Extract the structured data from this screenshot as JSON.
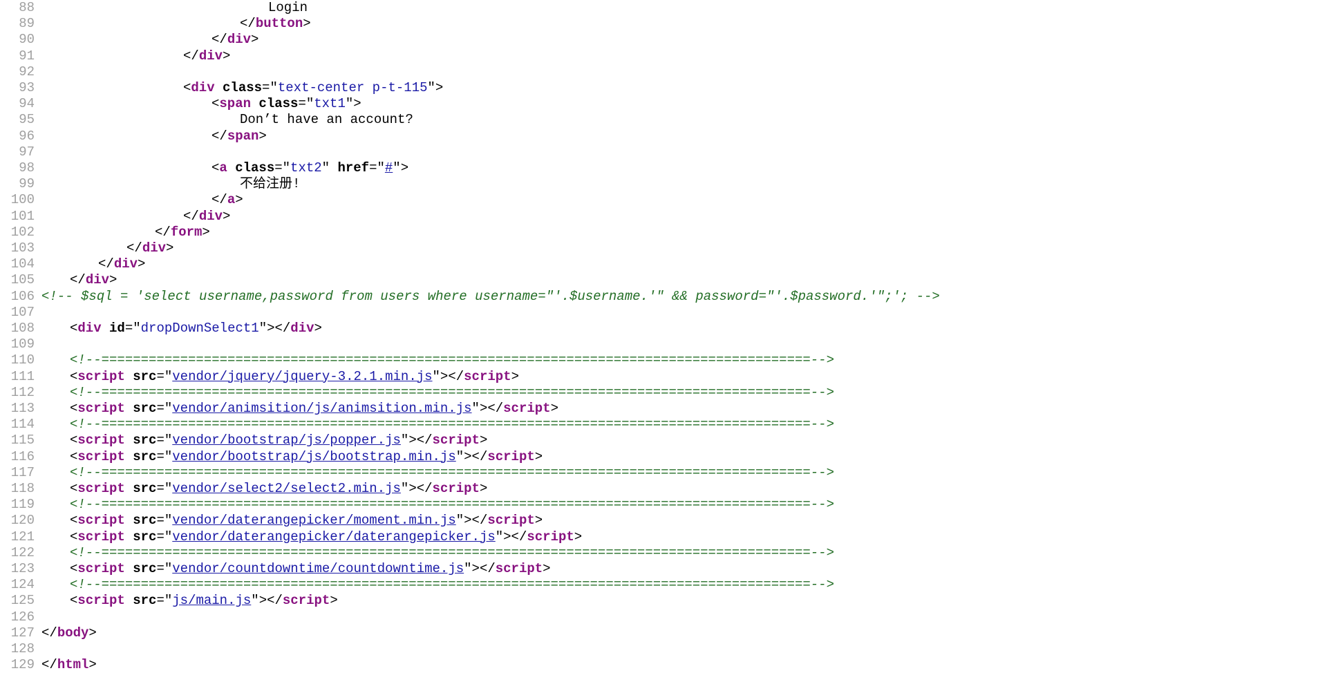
{
  "source_view": {
    "lines": [
      {
        "n": "88",
        "indent": 32,
        "parts": [
          {
            "k": "txt",
            "t": "Login"
          }
        ]
      },
      {
        "n": "89",
        "indent": 28,
        "parts": [
          {
            "k": "punct",
            "t": "</"
          },
          {
            "k": "tag",
            "t": "button"
          },
          {
            "k": "punct",
            "t": ">"
          }
        ]
      },
      {
        "n": "90",
        "indent": 24,
        "parts": [
          {
            "k": "punct",
            "t": "</"
          },
          {
            "k": "tag",
            "t": "div"
          },
          {
            "k": "punct",
            "t": ">"
          }
        ]
      },
      {
        "n": "91",
        "indent": 20,
        "parts": [
          {
            "k": "punct",
            "t": "</"
          },
          {
            "k": "tag",
            "t": "div"
          },
          {
            "k": "punct",
            "t": ">"
          }
        ]
      },
      {
        "n": "92",
        "indent": 0,
        "parts": []
      },
      {
        "n": "93",
        "indent": 20,
        "parts": [
          {
            "k": "punct",
            "t": "<"
          },
          {
            "k": "tag",
            "t": "div"
          },
          {
            "k": "txt",
            "t": " "
          },
          {
            "k": "attr",
            "t": "class"
          },
          {
            "k": "punct",
            "t": "=\""
          },
          {
            "k": "val",
            "t": "text-center p-t-115"
          },
          {
            "k": "punct",
            "t": "\">"
          }
        ]
      },
      {
        "n": "94",
        "indent": 24,
        "parts": [
          {
            "k": "punct",
            "t": "<"
          },
          {
            "k": "tag",
            "t": "span"
          },
          {
            "k": "txt",
            "t": " "
          },
          {
            "k": "attr",
            "t": "class"
          },
          {
            "k": "punct",
            "t": "=\""
          },
          {
            "k": "val",
            "t": "txt1"
          },
          {
            "k": "punct",
            "t": "\">"
          }
        ]
      },
      {
        "n": "95",
        "indent": 28,
        "parts": [
          {
            "k": "txt",
            "t": "Don’t have an account?"
          }
        ]
      },
      {
        "n": "96",
        "indent": 24,
        "parts": [
          {
            "k": "punct",
            "t": "</"
          },
          {
            "k": "tag",
            "t": "span"
          },
          {
            "k": "punct",
            "t": ">"
          }
        ]
      },
      {
        "n": "97",
        "indent": 0,
        "parts": []
      },
      {
        "n": "98",
        "indent": 24,
        "parts": [
          {
            "k": "punct",
            "t": "<"
          },
          {
            "k": "tag",
            "t": "a"
          },
          {
            "k": "txt",
            "t": " "
          },
          {
            "k": "attr",
            "t": "class"
          },
          {
            "k": "punct",
            "t": "=\""
          },
          {
            "k": "val",
            "t": "txt2"
          },
          {
            "k": "punct",
            "t": "\" "
          },
          {
            "k": "attr",
            "t": "href"
          },
          {
            "k": "punct",
            "t": "=\""
          },
          {
            "k": "lnk",
            "t": "#"
          },
          {
            "k": "punct",
            "t": "\">"
          }
        ]
      },
      {
        "n": "99",
        "indent": 28,
        "parts": [
          {
            "k": "txt",
            "t": "不给注册!"
          }
        ]
      },
      {
        "n": "100",
        "indent": 24,
        "parts": [
          {
            "k": "punct",
            "t": "</"
          },
          {
            "k": "tag",
            "t": "a"
          },
          {
            "k": "punct",
            "t": ">"
          }
        ]
      },
      {
        "n": "101",
        "indent": 20,
        "parts": [
          {
            "k": "punct",
            "t": "</"
          },
          {
            "k": "tag",
            "t": "div"
          },
          {
            "k": "punct",
            "t": ">"
          }
        ]
      },
      {
        "n": "102",
        "indent": 16,
        "parts": [
          {
            "k": "punct",
            "t": "</"
          },
          {
            "k": "tag",
            "t": "form"
          },
          {
            "k": "punct",
            "t": ">"
          }
        ]
      },
      {
        "n": "103",
        "indent": 12,
        "parts": [
          {
            "k": "punct",
            "t": "</"
          },
          {
            "k": "tag",
            "t": "div"
          },
          {
            "k": "punct",
            "t": ">"
          }
        ]
      },
      {
        "n": "104",
        "indent": 8,
        "parts": [
          {
            "k": "punct",
            "t": "</"
          },
          {
            "k": "tag",
            "t": "div"
          },
          {
            "k": "punct",
            "t": ">"
          }
        ]
      },
      {
        "n": "105",
        "indent": 4,
        "parts": [
          {
            "k": "punct",
            "t": "</"
          },
          {
            "k": "tag",
            "t": "div"
          },
          {
            "k": "punct",
            "t": ">"
          }
        ]
      },
      {
        "n": "106",
        "indent": 0,
        "parts": [
          {
            "k": "cmt",
            "t": "<!-- $sql = 'select username,password from users where username=\"'.$username.'\" && password=\"'.$password.'\";'; -->"
          }
        ]
      },
      {
        "n": "107",
        "indent": 0,
        "parts": []
      },
      {
        "n": "108",
        "indent": 4,
        "parts": [
          {
            "k": "punct",
            "t": "<"
          },
          {
            "k": "tag",
            "t": "div"
          },
          {
            "k": "txt",
            "t": " "
          },
          {
            "k": "attr",
            "t": "id"
          },
          {
            "k": "punct",
            "t": "=\""
          },
          {
            "k": "val",
            "t": "dropDownSelect1"
          },
          {
            "k": "punct",
            "t": "\"></"
          },
          {
            "k": "tag",
            "t": "div"
          },
          {
            "k": "punct",
            "t": ">"
          }
        ]
      },
      {
        "n": "109",
        "indent": 0,
        "parts": []
      },
      {
        "n": "110",
        "indent": 4,
        "parts": [
          {
            "k": "cmt",
            "t": "<!--==========================================================================================-->"
          }
        ]
      },
      {
        "n": "111",
        "indent": 4,
        "parts": [
          {
            "k": "punct",
            "t": "<"
          },
          {
            "k": "tag",
            "t": "script"
          },
          {
            "k": "txt",
            "t": " "
          },
          {
            "k": "attr",
            "t": "src"
          },
          {
            "k": "punct",
            "t": "=\""
          },
          {
            "k": "lnk",
            "t": "vendor/jquery/jquery-3.2.1.min.js"
          },
          {
            "k": "punct",
            "t": "\"></"
          },
          {
            "k": "tag",
            "t": "script"
          },
          {
            "k": "punct",
            "t": ">"
          }
        ]
      },
      {
        "n": "112",
        "indent": 4,
        "parts": [
          {
            "k": "cmt",
            "t": "<!--==========================================================================================-->"
          }
        ]
      },
      {
        "n": "113",
        "indent": 4,
        "parts": [
          {
            "k": "punct",
            "t": "<"
          },
          {
            "k": "tag",
            "t": "script"
          },
          {
            "k": "txt",
            "t": " "
          },
          {
            "k": "attr",
            "t": "src"
          },
          {
            "k": "punct",
            "t": "=\""
          },
          {
            "k": "lnk",
            "t": "vendor/animsition/js/animsition.min.js"
          },
          {
            "k": "punct",
            "t": "\"></"
          },
          {
            "k": "tag",
            "t": "script"
          },
          {
            "k": "punct",
            "t": ">"
          }
        ]
      },
      {
        "n": "114",
        "indent": 4,
        "parts": [
          {
            "k": "cmt",
            "t": "<!--==========================================================================================-->"
          }
        ]
      },
      {
        "n": "115",
        "indent": 4,
        "parts": [
          {
            "k": "punct",
            "t": "<"
          },
          {
            "k": "tag",
            "t": "script"
          },
          {
            "k": "txt",
            "t": " "
          },
          {
            "k": "attr",
            "t": "src"
          },
          {
            "k": "punct",
            "t": "=\""
          },
          {
            "k": "lnk",
            "t": "vendor/bootstrap/js/popper.js"
          },
          {
            "k": "punct",
            "t": "\"></"
          },
          {
            "k": "tag",
            "t": "script"
          },
          {
            "k": "punct",
            "t": ">"
          }
        ]
      },
      {
        "n": "116",
        "indent": 4,
        "parts": [
          {
            "k": "punct",
            "t": "<"
          },
          {
            "k": "tag",
            "t": "script"
          },
          {
            "k": "txt",
            "t": " "
          },
          {
            "k": "attr",
            "t": "src"
          },
          {
            "k": "punct",
            "t": "=\""
          },
          {
            "k": "lnk",
            "t": "vendor/bootstrap/js/bootstrap.min.js"
          },
          {
            "k": "punct",
            "t": "\"></"
          },
          {
            "k": "tag",
            "t": "script"
          },
          {
            "k": "punct",
            "t": ">"
          }
        ]
      },
      {
        "n": "117",
        "indent": 4,
        "parts": [
          {
            "k": "cmt",
            "t": "<!--==========================================================================================-->"
          }
        ]
      },
      {
        "n": "118",
        "indent": 4,
        "parts": [
          {
            "k": "punct",
            "t": "<"
          },
          {
            "k": "tag",
            "t": "script"
          },
          {
            "k": "txt",
            "t": " "
          },
          {
            "k": "attr",
            "t": "src"
          },
          {
            "k": "punct",
            "t": "=\""
          },
          {
            "k": "lnk",
            "t": "vendor/select2/select2.min.js"
          },
          {
            "k": "punct",
            "t": "\"></"
          },
          {
            "k": "tag",
            "t": "script"
          },
          {
            "k": "punct",
            "t": ">"
          }
        ]
      },
      {
        "n": "119",
        "indent": 4,
        "parts": [
          {
            "k": "cmt",
            "t": "<!--==========================================================================================-->"
          }
        ]
      },
      {
        "n": "120",
        "indent": 4,
        "parts": [
          {
            "k": "punct",
            "t": "<"
          },
          {
            "k": "tag",
            "t": "script"
          },
          {
            "k": "txt",
            "t": " "
          },
          {
            "k": "attr",
            "t": "src"
          },
          {
            "k": "punct",
            "t": "=\""
          },
          {
            "k": "lnk",
            "t": "vendor/daterangepicker/moment.min.js"
          },
          {
            "k": "punct",
            "t": "\"></"
          },
          {
            "k": "tag",
            "t": "script"
          },
          {
            "k": "punct",
            "t": ">"
          }
        ]
      },
      {
        "n": "121",
        "indent": 4,
        "parts": [
          {
            "k": "punct",
            "t": "<"
          },
          {
            "k": "tag",
            "t": "script"
          },
          {
            "k": "txt",
            "t": " "
          },
          {
            "k": "attr",
            "t": "src"
          },
          {
            "k": "punct",
            "t": "=\""
          },
          {
            "k": "lnk",
            "t": "vendor/daterangepicker/daterangepicker.js"
          },
          {
            "k": "punct",
            "t": "\"></"
          },
          {
            "k": "tag",
            "t": "script"
          },
          {
            "k": "punct",
            "t": ">"
          }
        ]
      },
      {
        "n": "122",
        "indent": 4,
        "parts": [
          {
            "k": "cmt",
            "t": "<!--==========================================================================================-->"
          }
        ]
      },
      {
        "n": "123",
        "indent": 4,
        "parts": [
          {
            "k": "punct",
            "t": "<"
          },
          {
            "k": "tag",
            "t": "script"
          },
          {
            "k": "txt",
            "t": " "
          },
          {
            "k": "attr",
            "t": "src"
          },
          {
            "k": "punct",
            "t": "=\""
          },
          {
            "k": "lnk",
            "t": "vendor/countdowntime/countdowntime.js"
          },
          {
            "k": "punct",
            "t": "\"></"
          },
          {
            "k": "tag",
            "t": "script"
          },
          {
            "k": "punct",
            "t": ">"
          }
        ]
      },
      {
        "n": "124",
        "indent": 4,
        "parts": [
          {
            "k": "cmt",
            "t": "<!--==========================================================================================-->"
          }
        ]
      },
      {
        "n": "125",
        "indent": 4,
        "parts": [
          {
            "k": "punct",
            "t": "<"
          },
          {
            "k": "tag",
            "t": "script"
          },
          {
            "k": "txt",
            "t": " "
          },
          {
            "k": "attr",
            "t": "src"
          },
          {
            "k": "punct",
            "t": "=\""
          },
          {
            "k": "lnk",
            "t": "js/main.js"
          },
          {
            "k": "punct",
            "t": "\"></"
          },
          {
            "k": "tag",
            "t": "script"
          },
          {
            "k": "punct",
            "t": ">"
          }
        ]
      },
      {
        "n": "126",
        "indent": 0,
        "parts": []
      },
      {
        "n": "127",
        "indent": 0,
        "parts": [
          {
            "k": "punct",
            "t": "</"
          },
          {
            "k": "tag",
            "t": "body"
          },
          {
            "k": "punct",
            "t": ">"
          }
        ]
      },
      {
        "n": "128",
        "indent": 0,
        "parts": []
      },
      {
        "n": "129",
        "indent": 0,
        "parts": [
          {
            "k": "punct",
            "t": "</"
          },
          {
            "k": "tag",
            "t": "html"
          },
          {
            "k": "punct",
            "t": ">"
          }
        ]
      }
    ]
  }
}
